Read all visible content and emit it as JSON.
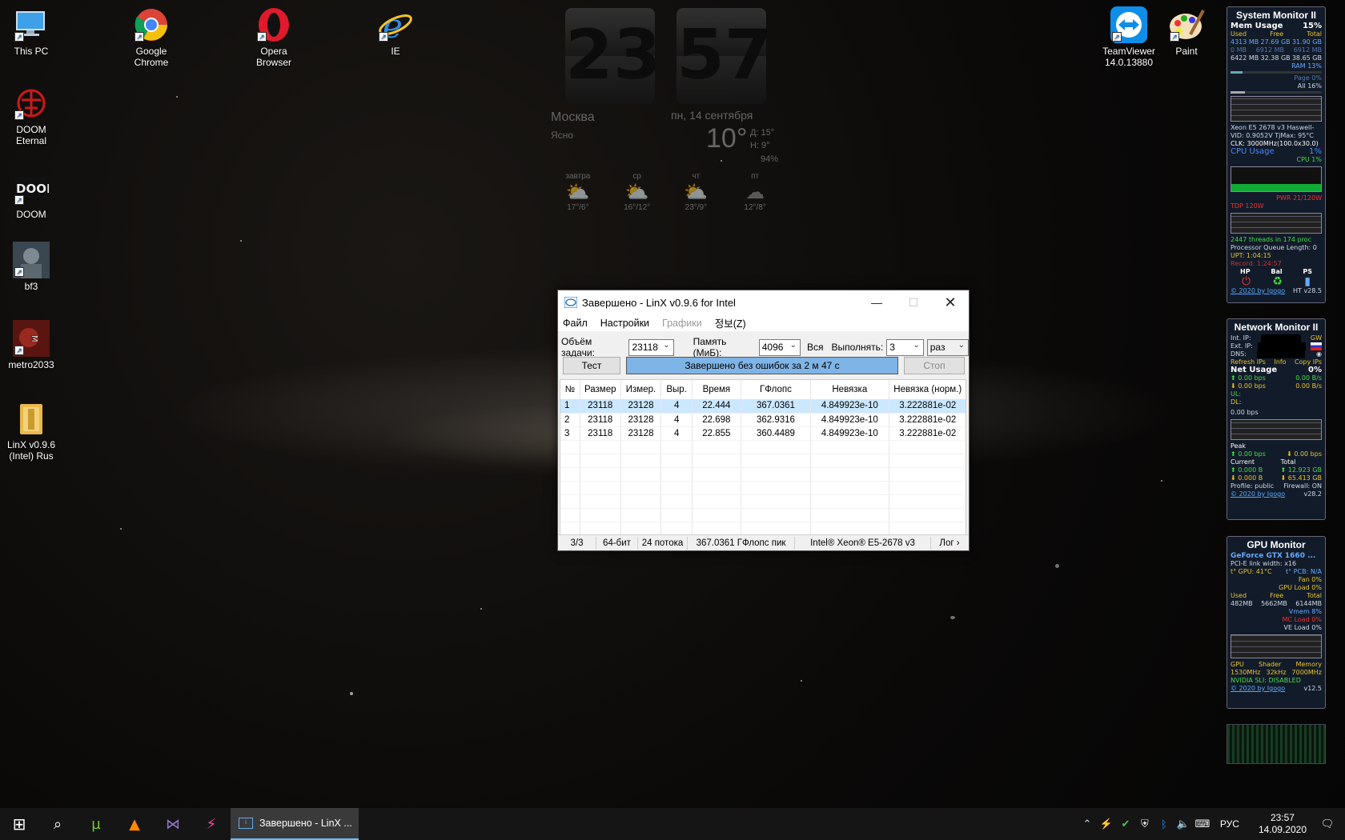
{
  "desktop": {
    "icons": [
      {
        "label": "This PC",
        "icon": "computer-icon"
      },
      {
        "label": "Google Chrome",
        "icon": "chrome-icon"
      },
      {
        "label": "Opera Browser",
        "icon": "opera-icon"
      },
      {
        "label": "IE",
        "icon": "ie-icon"
      },
      {
        "label": "DOOM Eternal",
        "icon": "doom-eternal-icon"
      },
      {
        "label": "DOOM",
        "icon": "doom-icon"
      },
      {
        "label": "bf3",
        "icon": "bf3-icon"
      },
      {
        "label": "metro2033",
        "icon": "metro2033-icon"
      },
      {
        "label": "LinX v0.9.6 (Intel) Rus",
        "icon": "folder-icon"
      },
      {
        "label": "TeamViewer 14.0.13880",
        "icon": "teamviewer-icon"
      },
      {
        "label": "Paint",
        "icon": "paint-icon"
      }
    ]
  },
  "clock": {
    "hours": "23",
    "minutes": "57",
    "city": "Москва",
    "condition": "Ясно",
    "date": "пн, 14 сентября",
    "temp": "10°",
    "high": "Д: 15°",
    "low": "Н: 9°",
    "humidity": "94%",
    "forecast": [
      {
        "day": "завтра",
        "temps": "17°/6°"
      },
      {
        "day": "ср",
        "temps": "16°/12°"
      },
      {
        "day": "чт",
        "temps": "23°/9°"
      },
      {
        "day": "пт",
        "temps": "12°/8°"
      }
    ]
  },
  "window": {
    "title": "Завершено - LinX v0.9.6 for Intel",
    "menu": [
      "Файл",
      "Настройки",
      "Графики",
      "정보(Z)"
    ],
    "task_size_label": "Объём задачи:",
    "task_size_value": "23118",
    "memory_label": "Память (МиБ):",
    "memory_value": "4096",
    "all_label": "Вся",
    "run_label": "Выполнять:",
    "run_value": "3",
    "run_unit": "раз",
    "test_button": "Тест",
    "stop_button": "Стоп",
    "progress_text": "Завершено без ошибок за 2 м 47 с",
    "progress_fraction": 1.0,
    "columns": [
      "№",
      "Размер",
      "Измер.",
      "Выр.",
      "Время",
      "ГФлопс",
      "Невязка",
      "Невязка (норм.)"
    ],
    "rows": [
      [
        "1",
        "23118",
        "23128",
        "4",
        "22.444",
        "367.0361",
        "4.849923e-10",
        "3.222881e-02"
      ],
      [
        "2",
        "23118",
        "23128",
        "4",
        "22.698",
        "362.9316",
        "4.849923e-10",
        "3.222881e-02"
      ],
      [
        "3",
        "23118",
        "23128",
        "4",
        "22.855",
        "360.4489",
        "4.849923e-10",
        "3.222881e-02"
      ]
    ],
    "status": {
      "progress": "3/3",
      "bits": "64-бит",
      "threads": "24 потока",
      "peak": "367.0361 ГФлопс пик",
      "cpu": "Intel® Xeon® E5-2678 v3",
      "log": "Лог ›"
    }
  },
  "system_monitor": {
    "title": "System Monitor II",
    "mem_head": "Mem Usage",
    "mem_pct": "15%",
    "cols": [
      "Used",
      "Free",
      "Total"
    ],
    "rows": [
      [
        "4313 MB",
        "27.69 GB",
        "31.90 GB"
      ],
      [
        "0 MB",
        "6912 MB",
        "6912 MB"
      ],
      [
        "6422 MB",
        "32.38 GB",
        "38.65 GB"
      ]
    ],
    "ram": "RAM 13%",
    "page": "Page 0%",
    "all": "All 16%",
    "cpu_name": "Xeon E5 2678 v3 Haswell-",
    "vid": "VID: 0.9052V TjMax: 95°C",
    "clk": "CLK: 3000MHz(100.0x30.0)",
    "cpu_head": "CPU Usage",
    "cpu_pct": "1%",
    "cpu_line": "CPU 1%",
    "pwr": "PWR 21/120W",
    "tdp": "TDP 120W",
    "threads": "2447 threads in 174 proc",
    "queue": "Processor Queue Length: 0",
    "upt": "UPT: 1:04:15",
    "record": "Record: 1:24:57",
    "hp_labels": [
      "HP",
      "Bal",
      "PS"
    ],
    "footer": "© 2020 by Igogo",
    "version": "HT v28.5"
  },
  "network_monitor": {
    "title": "Network Monitor II",
    "int_ip": "Int. IP:",
    "ext_ip": "Ext. IP:",
    "dns": "DNS:",
    "gw": "GW",
    "actions": [
      "Refresh IPs",
      "Info",
      "Copy IPs"
    ],
    "net_head": "Net Usage",
    "net_pct": "0%",
    "up1": "0.00 bps",
    "up2": "0.00 B/s",
    "dn1": "0.00 bps",
    "dn2": "0.00 B/s",
    "ul": "UL:",
    "dl": "DL:",
    "graph_label": "0.00 bps",
    "peak": "Peak",
    "peak_up": "0.00 bps",
    "peak_dn": "0.00 bps",
    "current": "Current",
    "total": "Total",
    "cur_up": "0.000 B",
    "tot_up": "12.923 GB",
    "cur_dn": "0.000 B",
    "tot_dn": "65.413 GB",
    "profile": "Profile: public",
    "firewall": "Firewall: ON",
    "footer": "© 2020 by Igogo",
    "version": "v28.2"
  },
  "gpu_monitor": {
    "title": "GPU Monitor",
    "gpu_name": "GeForce GTX 1660 ...",
    "pcie": "PCI-E link width: x16",
    "temp": "t° GPU: 41°C",
    "pcb": "t° PCB: N/A",
    "fan": "Fan 0%",
    "load": "GPU Load 0%",
    "cols": [
      "Used",
      "Free",
      "Total"
    ],
    "mem": [
      "482MB",
      "5662MB",
      "6144MB"
    ],
    "vmem": "Vmem 8%",
    "mc": "MC Load 0%",
    "ve": "VE Load 0%",
    "clock_cols": [
      "GPU",
      "Shader",
      "Memory"
    ],
    "clocks": [
      "1530MHz",
      "32kHz",
      "7000MHz"
    ],
    "sli": "NVIDIA SLI: DISABLED",
    "footer": "© 2020 by Igogo",
    "version": "v12.5"
  },
  "taskbar": {
    "active_label": "Завершено - LinX ...",
    "lang": "РУС",
    "time": "23:57",
    "date": "14.09.2020"
  }
}
